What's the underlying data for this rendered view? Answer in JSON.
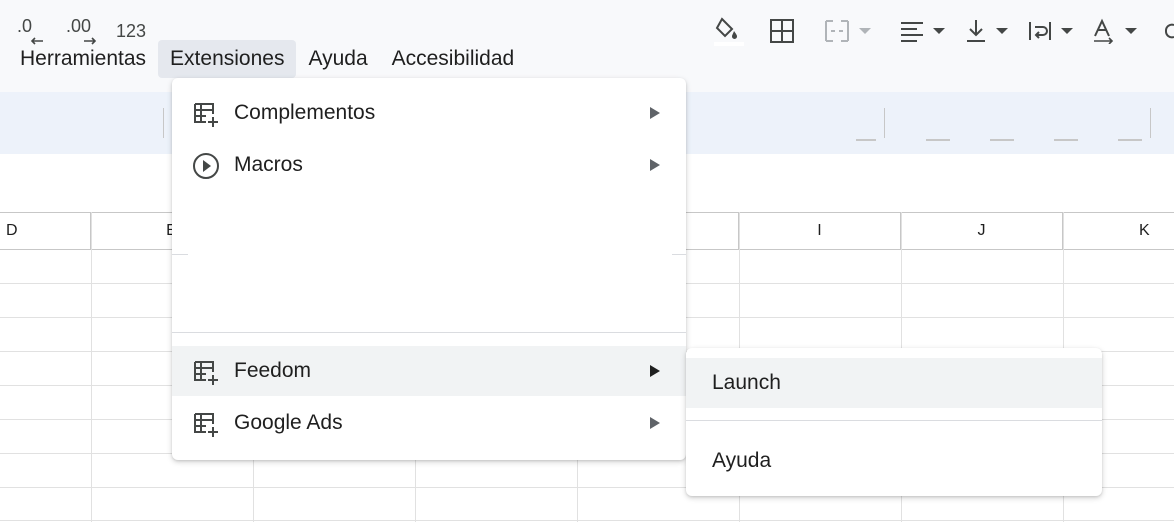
{
  "menubar": {
    "items": [
      {
        "label": "Herramientas"
      },
      {
        "label": "Extensiones"
      },
      {
        "label": "Ayuda"
      },
      {
        "label": "Accesibilidad"
      }
    ]
  },
  "toolbar": {
    "decrease_decimals": ".0",
    "increase_decimals": ".00",
    "more_formats": "123"
  },
  "columns": [
    "D",
    "E",
    "I",
    "J",
    "K"
  ],
  "extensions_menu": {
    "items": [
      {
        "label": "Complementos",
        "icon": "table-add-icon"
      },
      {
        "label": "Macros",
        "icon": "play-circle-icon"
      },
      {
        "label": "Feedom",
        "icon": "table-add-icon"
      },
      {
        "label": "Google Ads",
        "icon": "table-add-icon"
      }
    ]
  },
  "feedom_submenu": {
    "items": [
      {
        "label": "Launch"
      },
      {
        "label": "Ayuda"
      }
    ]
  },
  "colors": {
    "toolbar_bg": "#edf2fa",
    "menu_highlight": "#f1f3f4",
    "active_menu": "#e5e8ee"
  }
}
